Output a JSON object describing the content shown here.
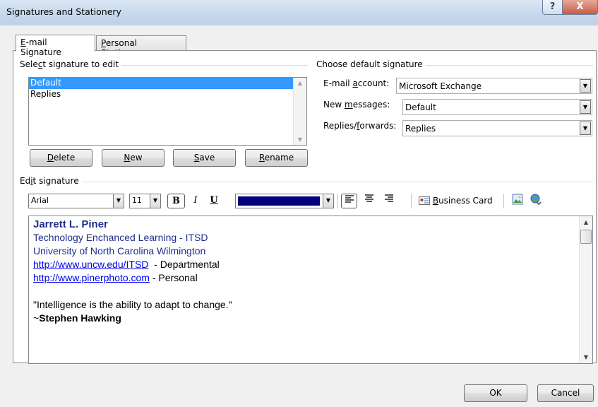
{
  "window": {
    "title": "Signatures and Stationery",
    "help_glyph": "?",
    "close_glyph": "X"
  },
  "tabs": [
    {
      "label_pre": "",
      "label_u": "E",
      "label_post": "-mail Signature"
    },
    {
      "label_pre": "",
      "label_u": "P",
      "label_post": "ersonal Stationery"
    }
  ],
  "select_section": {
    "label_pre": "Sele",
    "label_u": "c",
    "label_post": "t signature to edit"
  },
  "signatures": [
    "Default",
    "Replies"
  ],
  "sig_buttons": {
    "delete": {
      "pre": "",
      "u": "D",
      "post": "elete"
    },
    "new": {
      "pre": "",
      "u": "N",
      "post": "ew"
    },
    "save": {
      "pre": "",
      "u": "S",
      "post": "ave"
    },
    "rename": {
      "pre": "",
      "u": "R",
      "post": "ename"
    }
  },
  "default_section": {
    "label": "Choose default signature",
    "email_account": {
      "pre": "E-mail ",
      "u": "a",
      "post": "ccount:",
      "value": "Microsoft Exchange"
    },
    "new_messages": {
      "pre": "New ",
      "u": "m",
      "post": "essages:",
      "value": "Default"
    },
    "replies": {
      "pre": "Replies/",
      "u": "f",
      "post": "orwards:",
      "value": "Replies"
    }
  },
  "edit_section": {
    "label_pre": "Ed",
    "label_u": "i",
    "label_post": "t signature"
  },
  "toolbar": {
    "font": "Arial",
    "size": "11",
    "bold": "B",
    "italic": "I",
    "underline": "U",
    "color": "#000080",
    "business_card": {
      "pre": "",
      "u": "B",
      "post": "usiness Card"
    }
  },
  "signature": {
    "name": "Jarrett L. Piner",
    "line1": "Technology Enchanced Learning - ITSD",
    "line2": "University of North Carolina Wilmington",
    "link1": "http://www.uncw.edu/ITSD",
    "link1_suffix": "  - Departmental",
    "link2": "http://www.pinerphoto.com",
    "link2_suffix": " - Personal",
    "quote": "\"Intelligence is the ability to adapt to change.\"",
    "author_prefix": "~",
    "author": "Stephen Hawking"
  },
  "footer": {
    "ok": "OK",
    "cancel": "Cancel"
  }
}
